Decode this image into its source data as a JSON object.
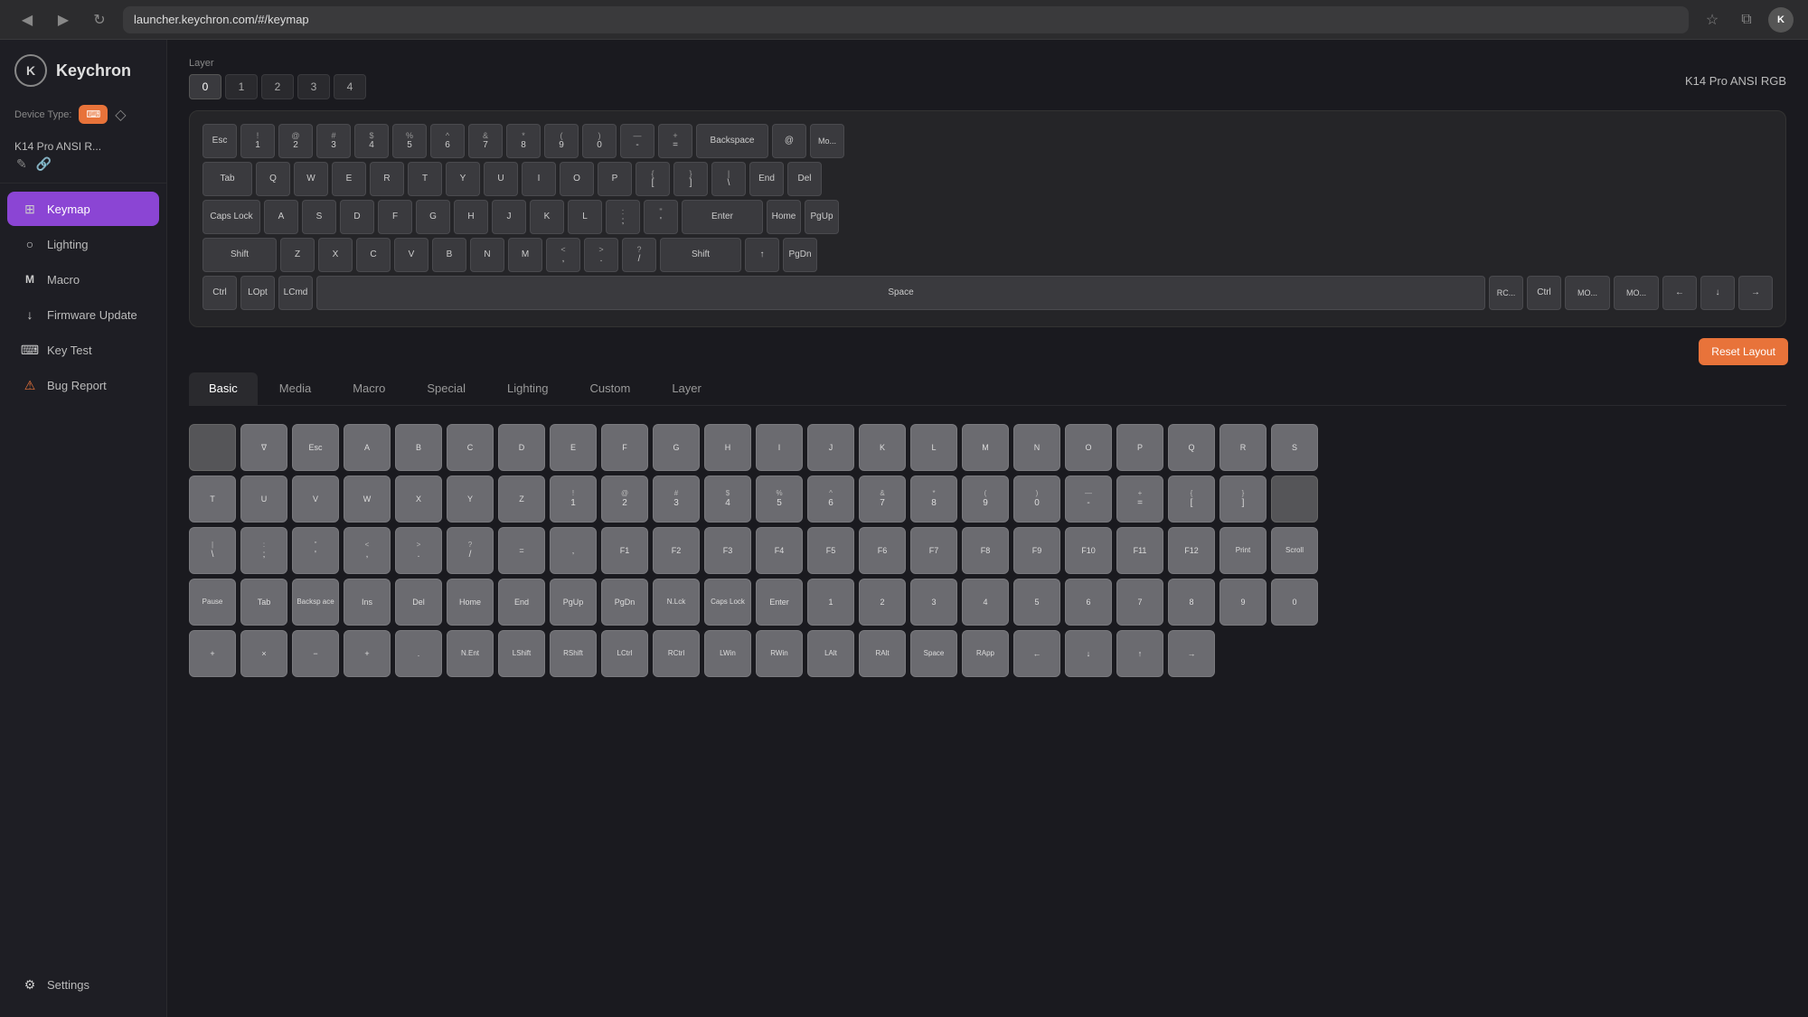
{
  "browser": {
    "url": "launcher.keychron.com/#/keymap",
    "back_icon": "◀",
    "forward_icon": "▶",
    "refresh_icon": "↻",
    "bookmark_icon": "☆",
    "extensions_icon": "⧉",
    "account_label": "K"
  },
  "sidebar": {
    "logo": "Keychron",
    "logo_letter": "K",
    "device_type_label": "Device Type:",
    "device_type_icon": "🖥",
    "device_name": "K14 Pro ANSI R...",
    "nav_items": [
      {
        "id": "keymap",
        "label": "Keymap",
        "icon": "⊞",
        "active": true
      },
      {
        "id": "lighting",
        "label": "Lighting",
        "icon": "○"
      },
      {
        "id": "macro",
        "label": "Macro",
        "icon": "M"
      },
      {
        "id": "firmware",
        "label": "Firmware Update",
        "icon": "↓"
      },
      {
        "id": "keytest",
        "label": "Key Test",
        "icon": "⌨"
      },
      {
        "id": "bugreport",
        "label": "Bug Report",
        "icon": "⚠"
      }
    ],
    "settings_label": "Settings",
    "settings_icon": "⚙"
  },
  "keyboard": {
    "layer_label": "Layer",
    "layers": [
      "0",
      "1",
      "2",
      "3",
      "4"
    ],
    "active_layer": "0",
    "model_label": "K14 Pro ANSI RGB",
    "reset_layout_label": "Reset Layout",
    "rows": [
      [
        "Esc",
        "! 1",
        "@ 2",
        "# 3",
        "$ 4",
        "% 5",
        "^ 6",
        "& 7",
        "* 8",
        "( 9",
        ") 0",
        "— -",
        "+ =",
        "Backspace",
        "@",
        "Mo..."
      ],
      [
        "Tab",
        "Q",
        "W",
        "E",
        "R",
        "T",
        "Y",
        "U",
        "I",
        "O",
        "P",
        "{ [",
        "} ]",
        "| \\",
        "End",
        "Del"
      ],
      [
        "Caps Lock",
        "A",
        "S",
        "D",
        "F",
        "G",
        "H",
        "J",
        "K",
        "L",
        ": ;",
        "\" '",
        "Enter",
        "Home",
        "PgUp"
      ],
      [
        "Shift",
        "Z",
        "X",
        "C",
        "V",
        "B",
        "N",
        "M",
        "< ,",
        "> .",
        "? /",
        "Shift",
        "↑",
        "PgDn"
      ],
      [
        "Ctrl",
        "LOpt",
        "LCmd",
        "Space",
        "RC...",
        "Ctrl",
        "MO...",
        "MO...",
        "←",
        "↓",
        "→"
      ]
    ]
  },
  "keymap_tabs": {
    "tabs": [
      "Basic",
      "Media",
      "Macro",
      "Special",
      "Lighting",
      "Custom",
      "Layer"
    ],
    "active_tab": "Basic"
  },
  "key_grid": {
    "rows": [
      [
        "",
        "∇",
        "Esc",
        "A",
        "B",
        "C",
        "D",
        "E",
        "F",
        "G",
        "H",
        "I",
        "J",
        "K",
        "L",
        "M",
        "N",
        "O",
        "P",
        "Q",
        "R",
        "S"
      ],
      [
        "T",
        "U",
        "V",
        "W",
        "X",
        "Y",
        "Z",
        "! 1",
        "@ 2",
        "# 3",
        "$ 4",
        "% 5",
        "^ 6",
        "& 7",
        "* 8",
        "( 9",
        ") 0",
        "— -",
        "+ =",
        "{ [",
        "} ]",
        ""
      ],
      [
        "| \\",
        ": ;",
        "' ",
        "< ,",
        "> .",
        "? /",
        "=",
        "，",
        "F1",
        "F2",
        "F3",
        "F4",
        "F5",
        "F6",
        "F7",
        "F8",
        "F9",
        "F10",
        "F11",
        "F12",
        "Print",
        "Scroll"
      ],
      [
        "Pause",
        "Tab",
        "Backspace",
        "Ins",
        "Del",
        "Home",
        "End",
        "PgUp",
        "PgDn",
        "N.Lck",
        "Caps Lock",
        "Enter",
        "1",
        "2",
        "3",
        "4",
        "5",
        "6",
        "7",
        "8",
        "9",
        "0"
      ],
      [
        "+",
        "×",
        "−",
        "+",
        ".",
        "N.Ent",
        "LShift",
        "RShift",
        "LCtrl",
        "RCtrl",
        "LWin",
        "RWin",
        "LAlt",
        "RAlt",
        "Space",
        "RApp",
        "←",
        "↓",
        "↑",
        "→"
      ]
    ]
  }
}
